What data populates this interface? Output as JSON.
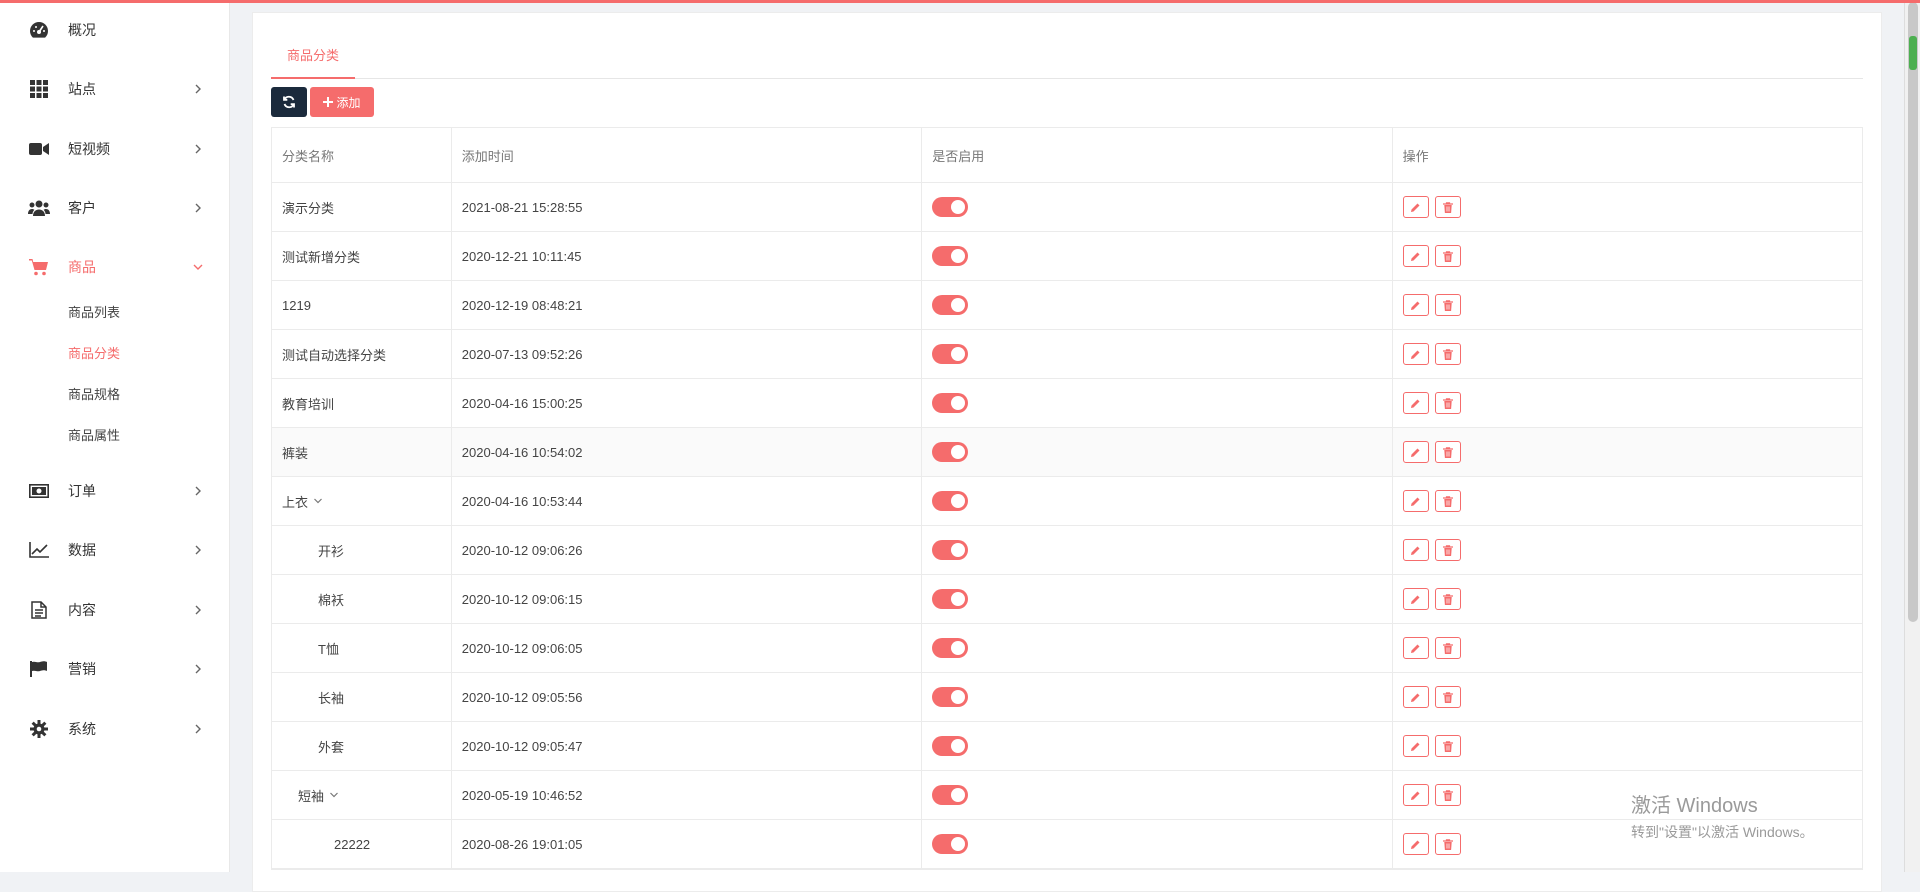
{
  "sidebar": {
    "items": [
      {
        "label": "概况",
        "icon": "dashboard-icon"
      },
      {
        "label": "站点",
        "icon": "grid-icon"
      },
      {
        "label": "短视频",
        "icon": "video-icon"
      },
      {
        "label": "客户",
        "icon": "users-icon"
      },
      {
        "label": "商品",
        "icon": "cart-icon"
      },
      {
        "label": "订单",
        "icon": "money-icon"
      },
      {
        "label": "数据",
        "icon": "line-chart-icon"
      },
      {
        "label": "内容",
        "icon": "document-icon"
      },
      {
        "label": "营销",
        "icon": "flag-icon"
      },
      {
        "label": "系统",
        "icon": "gear-icon"
      }
    ],
    "sub_items": [
      "商品列表",
      "商品分类",
      "商品规格",
      "商品属性"
    ]
  },
  "tab": {
    "label": "商品分类"
  },
  "toolbar": {
    "add_label": "添加"
  },
  "table": {
    "headers": [
      "分类名称",
      "添加时间",
      "是否启用",
      "操作"
    ],
    "rows": [
      {
        "name": "演示分类",
        "time": "2021-08-21 15:28:55"
      },
      {
        "name": "测试新增分类",
        "time": "2020-12-21 10:11:45"
      },
      {
        "name": "1219",
        "time": "2020-12-19 08:48:21"
      },
      {
        "name": "测试自动选择分类",
        "time": "2020-07-13 09:52:26"
      },
      {
        "name": "教育培训",
        "time": "2020-04-16 15:00:25"
      },
      {
        "name": "裤装",
        "time": "2020-04-16 10:54:02"
      },
      {
        "name": "上衣",
        "time": "2020-04-16 10:53:44"
      },
      {
        "name": "开衫",
        "time": "2020-10-12 09:06:26"
      },
      {
        "name": "棉袄",
        "time": "2020-10-12 09:06:15"
      },
      {
        "name": "T恤",
        "time": "2020-10-12 09:06:05"
      },
      {
        "name": "长袖",
        "time": "2020-10-12 09:05:56"
      },
      {
        "name": "外套",
        "time": "2020-10-12 09:05:47"
      },
      {
        "name": "短袖",
        "time": "2020-05-19 10:46:52"
      },
      {
        "name": "22222",
        "time": "2020-08-26 19:01:05"
      }
    ]
  },
  "watermark": {
    "line1": "激活 Windows",
    "line2": "转到\"设置\"以激活 Windows。"
  },
  "colors": {
    "accent": "#f56c6c",
    "dark": "#1b2a3c"
  }
}
